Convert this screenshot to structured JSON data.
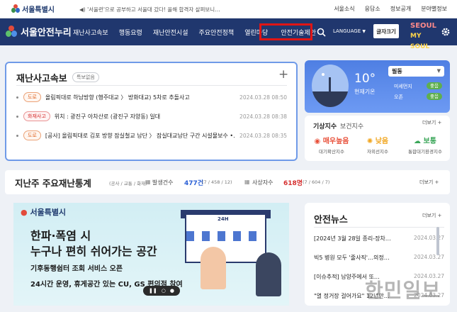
{
  "topbar": {
    "logo_text": "서울특별시",
    "ticker": "◀) '서울런'으로 공부하고 서울대 갔다! 올해 합격자 살펴보니…",
    "links": [
      "서울소식",
      "응답소",
      "정보공개",
      "분야별정보"
    ]
  },
  "nav": {
    "logo_text": "서울안전누리",
    "items": [
      "재난사고속보",
      "행동요령",
      "재난안전시설",
      "주요안전정책",
      "열린마당",
      "안전기술제안"
    ],
    "language": "LANGUAGE",
    "tts": "글자크기",
    "brand": [
      "SEOUL",
      "MY SOUL"
    ]
  },
  "disaster": {
    "title": "재난사고속보",
    "badge": "특보없음",
    "plus": "+",
    "items": [
      {
        "tag": "도로",
        "text": "올림픽대로 하남방향 (행주대교 〉 방화대교) 5차로 추돌사고",
        "date": "2024.03.28 08:50"
      },
      {
        "tag": "화재사고",
        "text": "위치 : 광진구 아차산로 (광진구 자양동) 일대",
        "date": "2024.03.28 08:38"
      },
      {
        "tag": "도로",
        "text": "[공사] 올림픽대로 김포 방향 잠실철교 남단 〉 잠실대교남단 구간 시설물보수 •…",
        "date": "2024.03.28 08:35"
      }
    ]
  },
  "weather": {
    "temp": "10°",
    "now_label": "현재기온",
    "district": "필동",
    "rows": [
      {
        "label": "미세먼지",
        "status": "좋음"
      },
      {
        "label": "오존",
        "status": "좋음"
      }
    ]
  },
  "climate": {
    "title": "기상지수",
    "subtitle": "보건지수",
    "more": "더보기 +",
    "items": [
      {
        "value": "매우높음",
        "label": "대기확산지수",
        "color": "#e8503a",
        "icon": "wind-icon"
      },
      {
        "value": "낮음",
        "label": "자외선지수",
        "color": "#f1a51d",
        "icon": "sun-icon"
      },
      {
        "value": "보통",
        "label": "통합대기환경지수",
        "color": "#3aa658",
        "icon": "cloud-icon"
      }
    ]
  },
  "stats": {
    "title": "지난주 주요재난통계",
    "category": "(공사 / 교통 / 화재)",
    "occurrence_label": "발생건수",
    "occurrence_value": "477건",
    "occurrence_detail": "(7 / 458 / 12)",
    "casualty_label": "사상자수",
    "casualty_value": "618명",
    "casualty_detail": "(7 / 604 / 7)",
    "more": "더보기 +"
  },
  "banner": {
    "logo": "서울특별시",
    "title1": "한파·폭염 시",
    "title2": "누구나 편히 쉬어가는 공간",
    "sub1": "기후동행쉼터 조회 서비스 오픈",
    "sub2": "24시간 운영, 휴게공간 있는 CU, GS 편의점 참여",
    "store_sign": "24H",
    "controls": [
      "❚❚",
      "○",
      "●"
    ]
  },
  "news": {
    "title": "안전뉴스",
    "more": "더보기 +",
    "items": [
      {
        "text": "[2024년 3월 28일 종리-장차…",
        "date": "2024.03.27"
      },
      {
        "text": "빅5 병원 모두 '줄사직'…의정…",
        "date": "2024.03.27"
      },
      {
        "text": "[이슈추적] 남양주에서 또…",
        "date": "2024.03.27"
      },
      {
        "text": "\"열 정거장 걸어가요\" 12년만…",
        "date": "2024.03.27"
      }
    ]
  },
  "watermark": "한민일보",
  "colors": {
    "navy": "#20376e",
    "accent_blue": "#6f9ae8",
    "highlight_red": "#e01515"
  }
}
